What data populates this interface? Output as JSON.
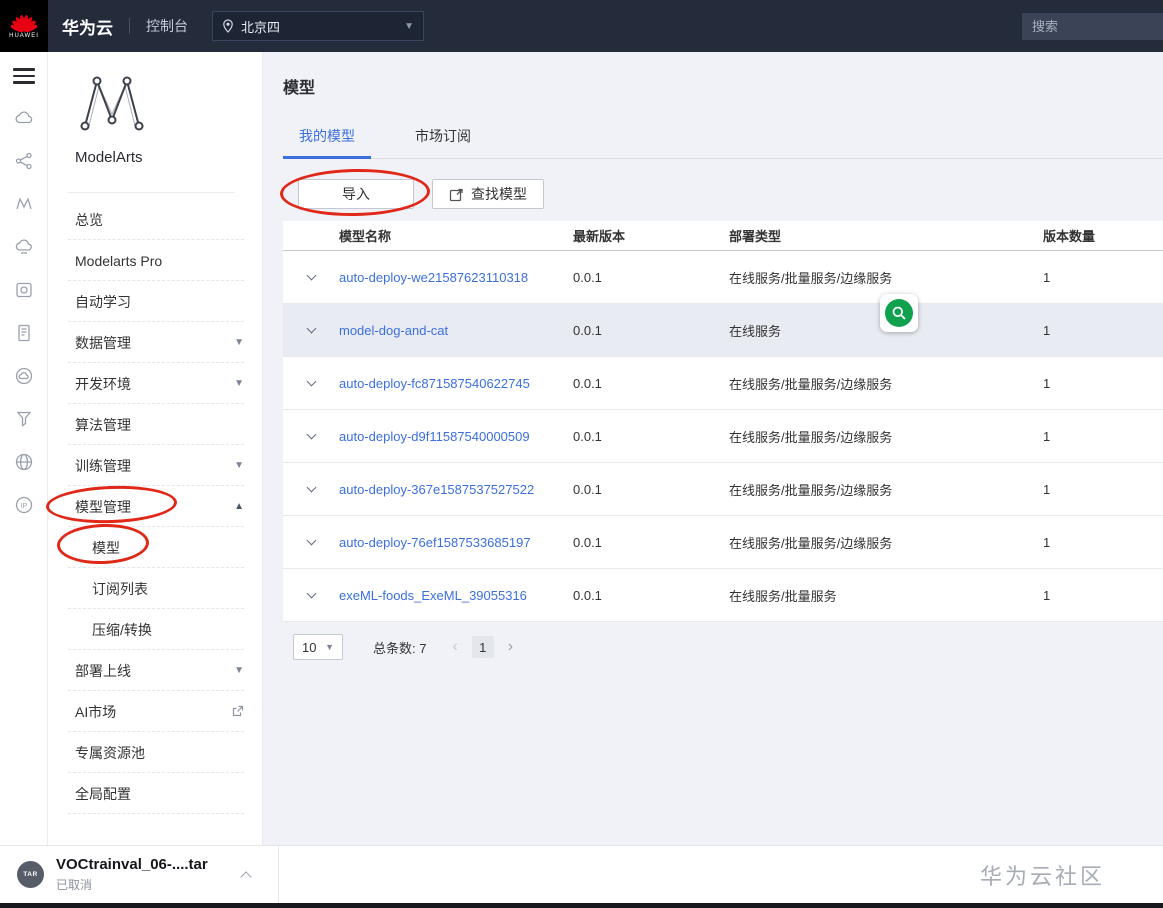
{
  "colors": {
    "accent": "#3b6fe0",
    "annotation_red": "#e02718",
    "annotation_green": "#0fa14e",
    "topbar_bg": "#242b3b"
  },
  "topbar": {
    "logo_text": "HUAWEI",
    "brand": "华为云",
    "console": "控制台",
    "region": "北京四",
    "search_placeholder": "搜索"
  },
  "rail": {
    "icons": [
      "menu",
      "cloud",
      "share-nodes",
      "modelarts-m",
      "cloud-service",
      "container",
      "document",
      "cloud-circle",
      "funnel",
      "globe",
      "ip"
    ]
  },
  "sidebar": {
    "product": "ModelArts",
    "items": [
      {
        "label": "总览"
      },
      {
        "label": "Modelarts Pro"
      },
      {
        "label": "自动学习"
      },
      {
        "label": "数据管理",
        "arrow": "down"
      },
      {
        "label": "开发环境",
        "arrow": "down"
      },
      {
        "label": "算法管理"
      },
      {
        "label": "训练管理",
        "arrow": "down"
      },
      {
        "label": "模型管理",
        "arrow": "up",
        "annotated": true
      },
      {
        "label": "模型",
        "sub": true,
        "selected": true,
        "annotated": true
      },
      {
        "label": "订阅列表",
        "sub": true
      },
      {
        "label": "压缩/转换",
        "sub": true
      },
      {
        "label": "部署上线",
        "arrow": "down"
      },
      {
        "label": "AI市场",
        "external": true
      },
      {
        "label": "专属资源池"
      },
      {
        "label": "全局配置"
      }
    ]
  },
  "main": {
    "title": "模型",
    "tabs": [
      {
        "label": "我的模型",
        "active": true
      },
      {
        "label": "市场订阅",
        "active": false
      }
    ],
    "toolbar": {
      "import": "导入",
      "find": "查找模型"
    },
    "table": {
      "headers": [
        "模型名称",
        "最新版本",
        "部署类型",
        "版本数量"
      ],
      "rows": [
        {
          "name": "auto-deploy-we21587623110318",
          "version": "0.0.1",
          "deploy": "在线服务/批量服务/边缘服务",
          "count": "1"
        },
        {
          "name": "model-dog-and-cat",
          "version": "0.0.1",
          "deploy": "在线服务",
          "count": "1",
          "highlighted": true
        },
        {
          "name": "auto-deploy-fc871587540622745",
          "version": "0.0.1",
          "deploy": "在线服务/批量服务/边缘服务",
          "count": "1"
        },
        {
          "name": "auto-deploy-d9f11587540000509",
          "version": "0.0.1",
          "deploy": "在线服务/批量服务/边缘服务",
          "count": "1"
        },
        {
          "name": "auto-deploy-367e1587537527522",
          "version": "0.0.1",
          "deploy": "在线服务/批量服务/边缘服务",
          "count": "1"
        },
        {
          "name": "auto-deploy-76ef1587533685197",
          "version": "0.0.1",
          "deploy": "在线服务/批量服务/边缘服务",
          "count": "1"
        },
        {
          "name": "exeML-foods_ExeML_39055316",
          "version": "0.0.1",
          "deploy": "在线服务/批量服务",
          "count": "1"
        }
      ]
    },
    "pagination": {
      "page_size": "10",
      "total": "总条数: 7",
      "page": "1"
    }
  },
  "footer": {
    "file_name": "VOCtrainval_06-....tar",
    "file_badge": "TAR",
    "status": "已取消",
    "watermark": "华为云社区"
  }
}
